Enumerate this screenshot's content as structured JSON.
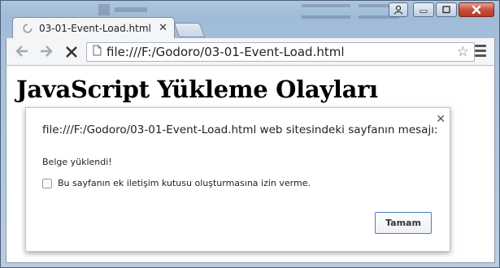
{
  "browser": {
    "tab": {
      "title": "03-01-Event-Load.html"
    },
    "address_bar": {
      "url": "file:///F:/Godoro/03-01-Event-Load.html"
    }
  },
  "page": {
    "heading": "JavaScript Yükleme Olayları"
  },
  "dialog": {
    "title": "file:///F:/Godoro/03-01-Event-Load.html web sitesindeki sayfanın mesajı:",
    "message": "Belge yüklendi!",
    "checkbox_label": "Bu sayfanın ek iletişim kutusu oluşturmasına izin verme.",
    "checkbox_checked": false,
    "ok_label": "Tamam"
  },
  "icons": {
    "tab_loading": "loading-spinner-icon",
    "back": "back-arrow-icon",
    "forward": "forward-arrow-icon",
    "stop": "stop-x-icon",
    "page": "page-icon",
    "bookmark": "star-icon",
    "menu": "hamburger-menu-icon",
    "dialog_close": "close-icon"
  },
  "colors": {
    "window_frame": "#a7c1dc",
    "close_button": "#c7513b",
    "ok_button_border": "#4d7cc7"
  }
}
